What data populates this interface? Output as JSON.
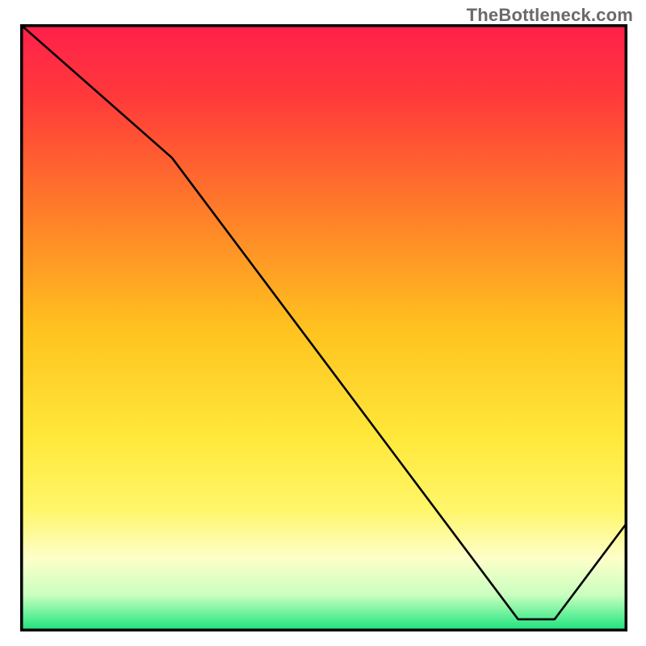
{
  "watermark": "TheBottleneck.com",
  "chart_data": {
    "type": "line",
    "title": "",
    "xlabel": "",
    "ylabel": "",
    "xlim": [
      0,
      100
    ],
    "ylim": [
      0,
      100
    ],
    "grid": false,
    "series": [
      {
        "name": "curve",
        "x": [
          0,
          25,
          82,
          88,
          100
        ],
        "y": [
          100,
          78,
          2,
          2,
          18
        ]
      }
    ],
    "annotations": [
      {
        "text": "",
        "x": 80,
        "y": 2
      }
    ],
    "gradient_stops": [
      {
        "offset": 0.0,
        "color": "#ff1f4b"
      },
      {
        "offset": 0.12,
        "color": "#ff3a3a"
      },
      {
        "offset": 0.3,
        "color": "#ff7a2a"
      },
      {
        "offset": 0.5,
        "color": "#ffc21f"
      },
      {
        "offset": 0.68,
        "color": "#ffe83a"
      },
      {
        "offset": 0.8,
        "color": "#fff66a"
      },
      {
        "offset": 0.88,
        "color": "#fdffc9"
      },
      {
        "offset": 0.94,
        "color": "#c9ffbf"
      },
      {
        "offset": 0.97,
        "color": "#6ef29d"
      },
      {
        "offset": 1.0,
        "color": "#18e07a"
      }
    ]
  }
}
